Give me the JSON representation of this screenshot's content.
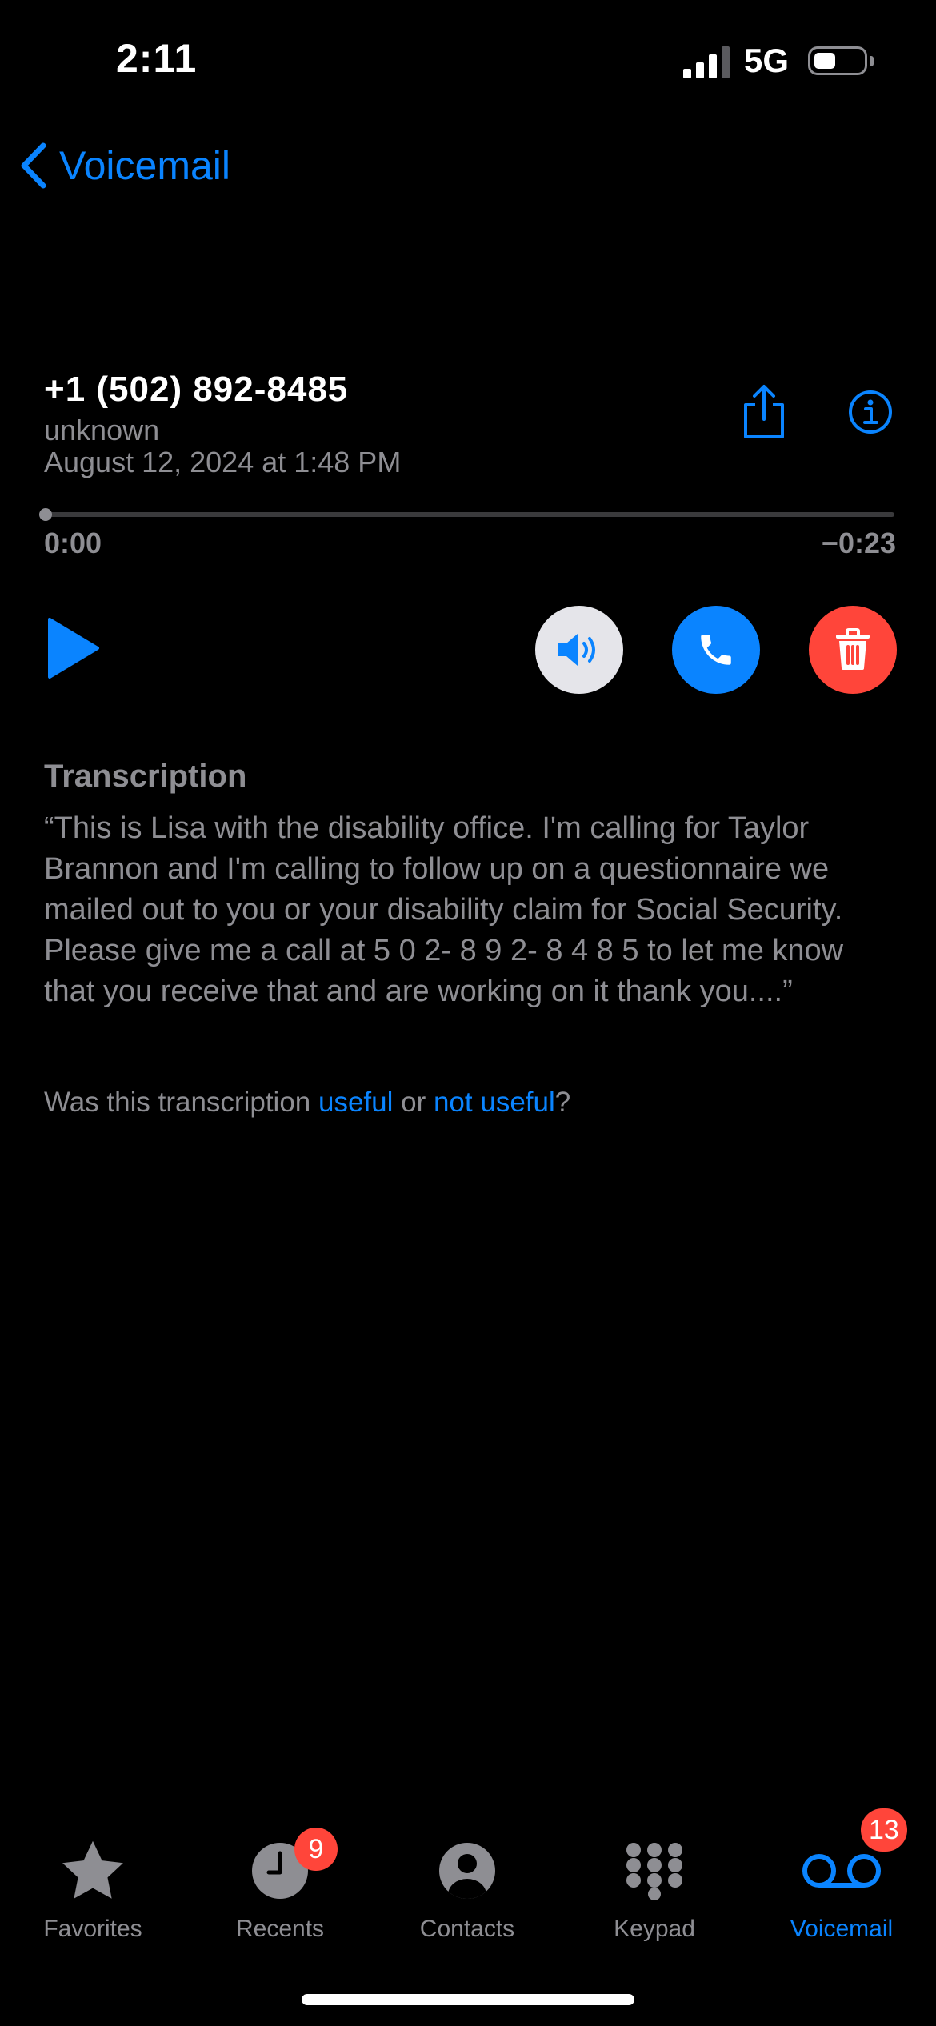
{
  "status_bar": {
    "time": "2:11",
    "network": "5G",
    "signal_bars_active": 3,
    "signal_bars_total": 4,
    "battery_level": 0.35
  },
  "nav": {
    "back_label": "Voicemail"
  },
  "voicemail": {
    "phone_number": "+1 (502) 892-8485",
    "caller_label": "unknown",
    "date": "August 12, 2024 at 1:48 PM",
    "elapsed": "0:00",
    "remaining": "−0:23",
    "progress": 0.0
  },
  "transcription": {
    "heading": "Transcription",
    "text": "“This is Lisa with the disability office. I'm calling for Taylor Brannon and I'm calling to follow up on a questionnaire we mailed out to you or your disability claim for Social Security. Please give me a call at 5 0 2- 8 9 2- 8 4 8 5 to let me know that you receive that and are working on it thank you....”",
    "feedback_prefix": "Was this transcription ",
    "useful_label": "useful",
    "feedback_or": " or ",
    "not_useful_label": "not useful",
    "feedback_suffix": "?"
  },
  "tab_bar": {
    "favorites": {
      "label": "Favorites",
      "icon": "star-icon"
    },
    "recents": {
      "label": "Recents",
      "icon": "clock-icon",
      "badge": "9"
    },
    "contacts": {
      "label": "Contacts",
      "icon": "person-icon"
    },
    "keypad": {
      "label": "Keypad",
      "icon": "keypad-icon"
    },
    "voicemail": {
      "label": "Voicemail",
      "icon": "voicemail-icon",
      "badge": "13",
      "active": true
    }
  },
  "colors": {
    "accent": "#0a84ff",
    "destructive": "#ff453a",
    "secondary_text": "#8e8e93",
    "background": "#000000"
  }
}
